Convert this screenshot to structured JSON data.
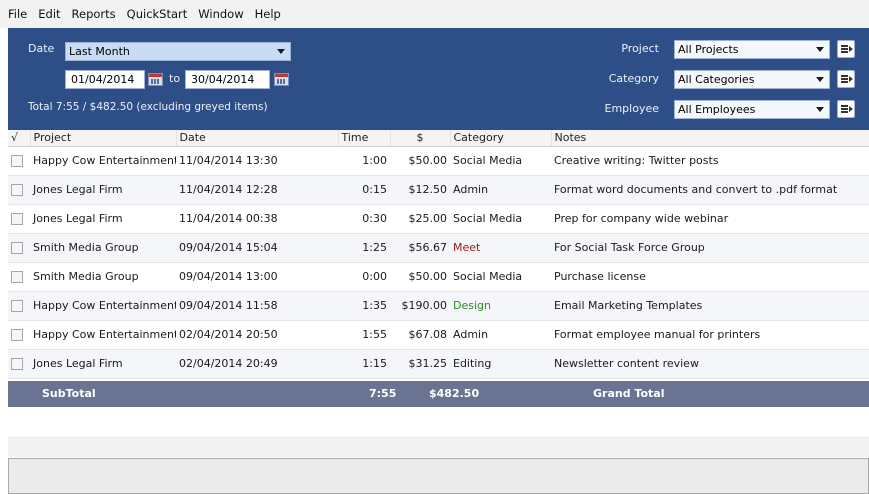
{
  "menu": [
    "File",
    "Edit",
    "Reports",
    "QuickStart",
    "Window",
    "Help"
  ],
  "filters": {
    "date_label": "Date",
    "date_range": "Last Month",
    "from_date": "01/04/2014",
    "to_label": "to",
    "to_date": "30/04/2014",
    "total_text": "Total  7:55 / $482.50 (excluding greyed items)",
    "project_label": "Project",
    "project_value": "All Projects",
    "category_label": "Category",
    "category_value": "All Categories",
    "employee_label": "Employee",
    "employee_value": "All Employees"
  },
  "table": {
    "headers": {
      "check": "√",
      "project": "Project",
      "date": "Date",
      "time": "Time",
      "amount": "$",
      "category": "Category",
      "notes": "Notes"
    },
    "rows": [
      {
        "project": "Happy Cow Entertainment",
        "date": "11/04/2014 13:30",
        "time": "1:00",
        "amount": "$50.00",
        "category": "Social Media",
        "notes": "Creative writing: Twitter posts"
      },
      {
        "project": "Jones Legal Firm",
        "date": "11/04/2014 12:28",
        "time": "0:15",
        "amount": "$12.50",
        "category": "Admin",
        "notes": "Format word documents and convert to .pdf format"
      },
      {
        "project": "Jones Legal Firm",
        "date": "11/04/2014 00:38",
        "time": "0:30",
        "amount": "$25.00",
        "category": "Social Media",
        "notes": "Prep for company wide webinar"
      },
      {
        "project": "Smith Media Group",
        "date": "09/04/2014 15:04",
        "time": "1:25",
        "amount": "$56.67",
        "category": "Meet",
        "notes": "For Social Task Force Group"
      },
      {
        "project": "Smith Media Group",
        "date": "09/04/2014 13:00",
        "time": "0:00",
        "amount": "$50.00",
        "category": "Social Media",
        "notes": "Purchase license"
      },
      {
        "project": "Happy Cow Entertainment",
        "date": "09/04/2014 11:58",
        "time": "1:35",
        "amount": "$190.00",
        "category": "Design",
        "notes": "Email Marketing Templates"
      },
      {
        "project": "Happy Cow Entertainment",
        "date": "02/04/2014 20:50",
        "time": "1:55",
        "amount": "$67.08",
        "category": "Admin",
        "notes": "Format employee manual for printers"
      },
      {
        "project": "Jones Legal Firm",
        "date": "02/04/2014 20:49",
        "time": "1:15",
        "amount": "$31.25",
        "category": "Editing",
        "notes": "Newsletter content review"
      }
    ],
    "category_colors": {
      "Meet": "#a01818",
      "Design": "#2e8b22"
    }
  },
  "subtotal": {
    "label": "SubTotal",
    "time": "7:55",
    "amount": "$482.50",
    "grand_label": "Grand Total"
  },
  "colors": {
    "filter_panel": "#2d4e86",
    "subtotal_bar": "#6a7391"
  },
  "icons": [
    "calendar-icon",
    "calendar-icon",
    "go-arrow-icon",
    "go-arrow-icon",
    "go-arrow-icon",
    "dropdown-arrow-icon",
    "checkbox-icon"
  ]
}
